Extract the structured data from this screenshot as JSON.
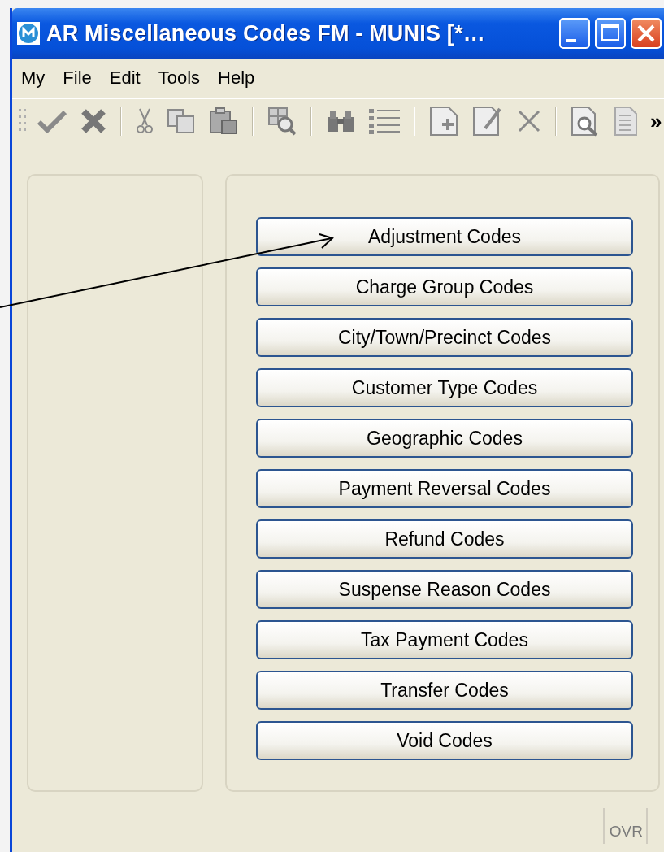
{
  "window": {
    "title": "AR Miscellaneous Codes FM - MUNIS [*…"
  },
  "menu": [
    {
      "label": "My"
    },
    {
      "label": "File"
    },
    {
      "label": "Edit"
    },
    {
      "label": "Tools"
    },
    {
      "label": "Help"
    }
  ],
  "toolbar": {
    "overflow": "»"
  },
  "buttons": [
    {
      "label": "Adjustment Codes"
    },
    {
      "label": "Charge Group Codes"
    },
    {
      "label": "City/Town/Precinct Codes"
    },
    {
      "label": "Customer Type Codes"
    },
    {
      "label": "Geographic Codes"
    },
    {
      "label": "Payment Reversal Codes"
    },
    {
      "label": "Refund Codes"
    },
    {
      "label": "Suspense Reason Codes"
    },
    {
      "label": "Tax Payment Codes"
    },
    {
      "label": "Transfer Codes"
    },
    {
      "label": "Void Codes"
    }
  ],
  "status_bar": [
    "OVR"
  ]
}
